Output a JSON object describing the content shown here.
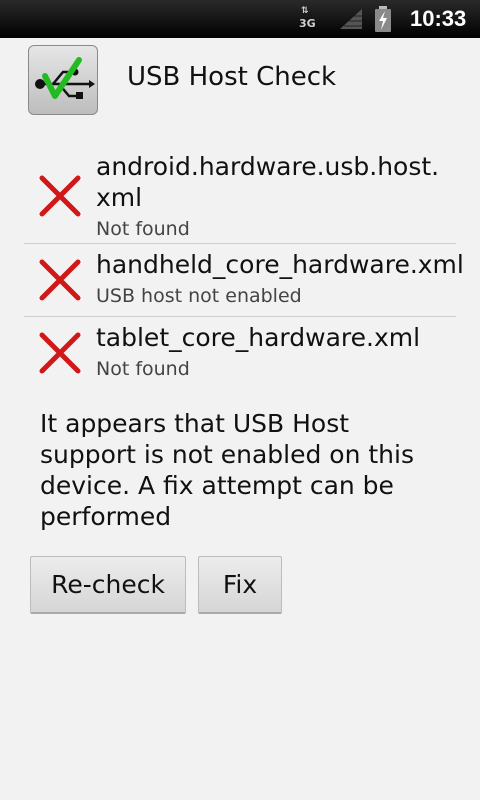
{
  "status_bar": {
    "network": "3G",
    "time": "10:33",
    "icons": [
      "network-3g-icon",
      "signal-icon",
      "battery-charging-icon"
    ]
  },
  "app": {
    "title": "USB Host Check",
    "icon": "usb-check-icon"
  },
  "checks": [
    {
      "filename": "android.hardware.usb.host.\nxml",
      "status": "Not found",
      "result": "fail",
      "icon": "red-x-icon"
    },
    {
      "filename": "handheld_core_hardware.xml",
      "status": "USB host not enabled",
      "result": "fail",
      "icon": "red-x-icon"
    },
    {
      "filename": "tablet_core_hardware.xml",
      "status": "Not found",
      "result": "fail",
      "icon": "red-x-icon"
    }
  ],
  "message": "It appears that USB Host support is not enabled on this device. A fix attempt can be performed",
  "buttons": {
    "recheck_label": "Re-check",
    "fix_label": "Fix"
  },
  "colors": {
    "fail_x": "#d01818",
    "check_green": "#22bb22",
    "background": "#f2f2f2"
  }
}
